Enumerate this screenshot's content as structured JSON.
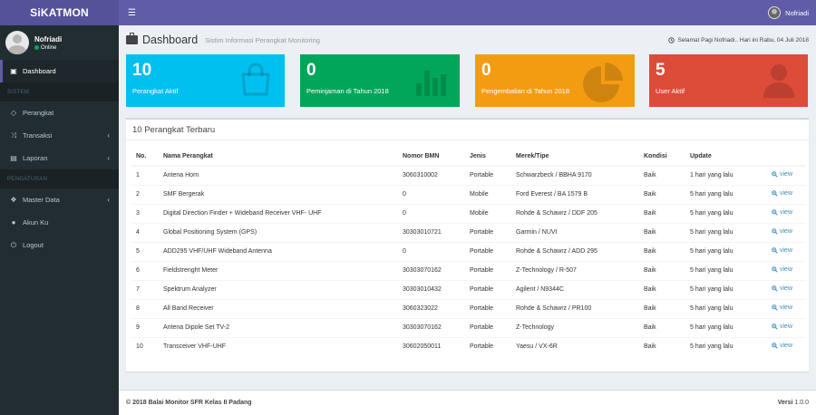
{
  "app": {
    "logo": "SiKATMON",
    "user_name": "Nofriadi"
  },
  "sidebar": {
    "user_name": "Nofriadi",
    "user_status": "Online",
    "items": [
      {
        "type": "item",
        "label": "Dashboard",
        "icon": "dashboard-icon",
        "active": true
      },
      {
        "type": "header",
        "label": "SISTEM"
      },
      {
        "type": "item",
        "label": "Perangkat",
        "icon": "diamond-icon"
      },
      {
        "type": "item",
        "label": "Transaksi",
        "icon": "shuffle-icon",
        "chevron": true
      },
      {
        "type": "item",
        "label": "Laporan",
        "icon": "file-icon",
        "chevron": true
      },
      {
        "type": "header",
        "label": "PENGATURAN"
      },
      {
        "type": "item",
        "label": "Master Data",
        "icon": "cubes-icon",
        "chevron": true
      },
      {
        "type": "item",
        "label": "Akun Ku",
        "icon": "user-icon"
      },
      {
        "type": "item",
        "label": "Logout",
        "icon": "power-icon"
      }
    ]
  },
  "header": {
    "title": "Dashboard",
    "subtitle": "Sistim Informasi Perangkat Monitoring",
    "greeting": "Selamat Pagi Nofriadi.. Hari ini Rabu, 04 Juli 2018"
  },
  "stats": [
    {
      "value": "10",
      "label": "Perangkat Aktif",
      "color": "#00c0ef",
      "icon": "shopping-bag-icon"
    },
    {
      "value": "0",
      "label": "Peminjaman di Tahun 2018",
      "color": "#00a65a",
      "icon": "bar-chart-icon"
    },
    {
      "value": "0",
      "label": "Pengembalian di Tahun 2018",
      "color": "#f39c12",
      "icon": "pie-chart-icon"
    },
    {
      "value": "5",
      "label": "User Aktif",
      "color": "#dd4b39",
      "icon": "user-silhouette-icon"
    }
  ],
  "table": {
    "title": "10 Perangkat Terbaru",
    "columns": [
      "No.",
      "Nama Perangkat",
      "Nomor BMN",
      "Jenis",
      "Merek/Tipe",
      "Kondisi",
      "Update",
      ""
    ],
    "view_label": "view",
    "rows": [
      [
        "1",
        "Antena Horn",
        "3060310002",
        "Portable",
        "Schwarzbeck / BBHA 9170",
        "Baik",
        "1 hari yang lalu"
      ],
      [
        "2",
        "SMF Bergerak",
        "0",
        "Mobile",
        "Ford Everest / BA 1579 B",
        "Baik",
        "5 hari yang lalu"
      ],
      [
        "3",
        "Digital Direction Finder + Wideband Receiver VHF- UHF",
        "0",
        "Mobile",
        "Rohde & Schawrz / DDF 205",
        "Baik",
        "5 hari yang lalu"
      ],
      [
        "4",
        "Global Positioning System (GPS)",
        "30303010721",
        "Portable",
        "Garmin / NUVI",
        "Baik",
        "5 hari yang lalu"
      ],
      [
        "5",
        "ADD295 VHF/UHF Wideband Antenna",
        "0",
        "Portable",
        "Rohde & Schawrz / ADD 295",
        "Baik",
        "5 hari yang lalu"
      ],
      [
        "6",
        "Fieldstrenght Meter",
        "30303070162",
        "Portable",
        "Z-Technology / R-507",
        "Baik",
        "5 hari yang lalu"
      ],
      [
        "7",
        "Spektrum Analyzer",
        "30303010432",
        "Portable",
        "Agilent / N9344C",
        "Baik",
        "5 hari yang lalu"
      ],
      [
        "8",
        "All Band Receiver",
        "3060323022",
        "Portable",
        "Rohde & Schawrz / PR100",
        "Baik",
        "5 hari yang lalu"
      ],
      [
        "9",
        "Antena Dipole Set TV-2",
        "30303070162",
        "Portable",
        "Z-Technology",
        "Baik",
        "5 hari yang lalu"
      ],
      [
        "10",
        "Transceiver VHF-UHF",
        "30602050011",
        "Portable",
        "Yaesu / VX-6R",
        "Baik",
        "5 hari yang lalu"
      ]
    ]
  },
  "footer": {
    "copyright": "© 2018 Balai Monitor SFR Kelas II Padang",
    "version_label": "Versi",
    "version": "1.0.0"
  }
}
